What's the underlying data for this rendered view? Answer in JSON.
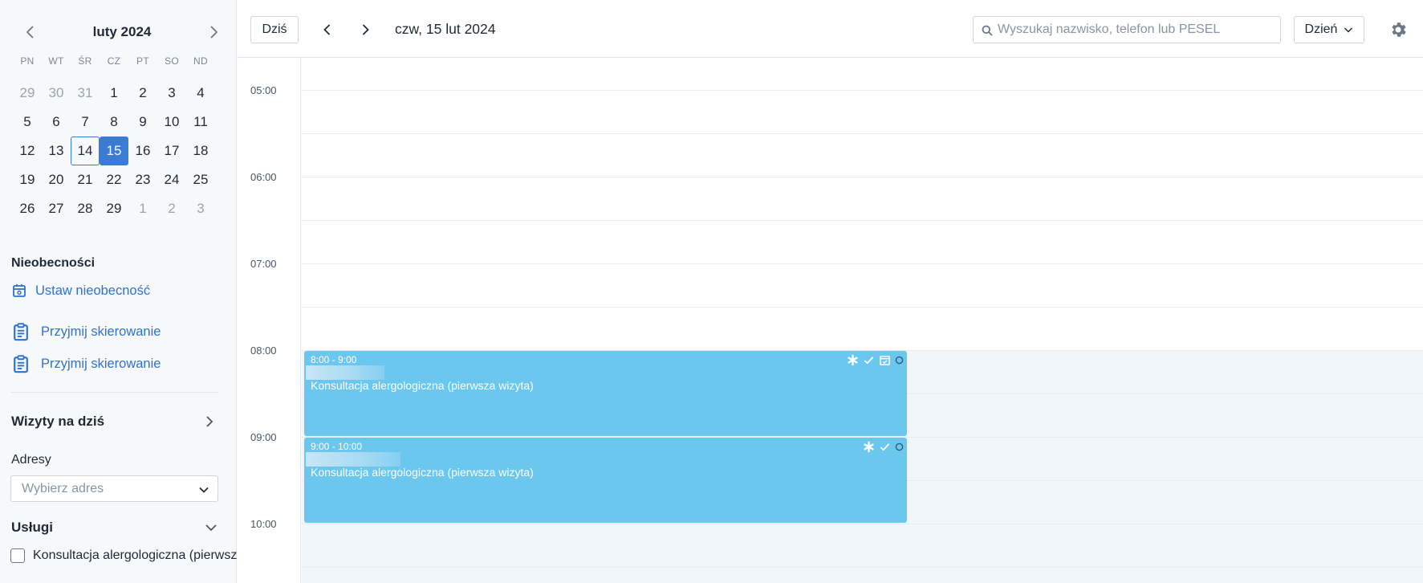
{
  "calendar": {
    "month_title": "luty 2024",
    "weekdays": [
      "PN",
      "WT",
      "ŚR",
      "CZ",
      "PT",
      "SO",
      "ND"
    ],
    "weeks": [
      [
        "29",
        "30",
        "31",
        "1",
        "2",
        "3",
        "4"
      ],
      [
        "5",
        "6",
        "7",
        "8",
        "9",
        "10",
        "11"
      ],
      [
        "12",
        "13",
        "14",
        "15",
        "16",
        "17",
        "18"
      ],
      [
        "19",
        "20",
        "21",
        "22",
        "23",
        "24",
        "25"
      ],
      [
        "26",
        "27",
        "28",
        "29",
        "1",
        "2",
        "3"
      ]
    ]
  },
  "sidebar": {
    "absences_title": "Nieobecności",
    "set_absence": "Ustaw nieobecność",
    "referral_1": "Przyjmij skierowanie",
    "referral_2": "Przyjmij skierowanie",
    "visits_today": "Wizyty na dziś",
    "addresses_title": "Adresy",
    "address_placeholder": "Wybierz adres",
    "services_title": "Usługi",
    "service_item": "Konsultacja alergologiczna (pierwsza wizyta)"
  },
  "toolbar": {
    "today_button": "Dziś",
    "date": "czw, 15 lut 2024",
    "search_placeholder": "Wyszukaj nazwisko, telefon lub PESEL",
    "view_label": "Dzień"
  },
  "time_labels": [
    "05:00",
    "06:00",
    "07:00",
    "08:00",
    "09:00",
    "10:00"
  ],
  "events": [
    {
      "time": "8:00 - 9:00",
      "title": "Konsultacja alergologiczna (pierwsza wizyta)"
    },
    {
      "time": "9:00 - 10:00",
      "title": "Konsultacja alergologiczna (pierwsza wizyta)"
    }
  ],
  "colors": {
    "accent": "#3a7bd5",
    "link": "#2f73c9",
    "event": "#6cc7ef",
    "working_hours": "#eff6fc"
  },
  "icons": {
    "prev": "chevron-left-icon",
    "next": "chevron-right-icon",
    "search": "search-icon",
    "settings": "gear-icon",
    "absence": "calendar-icon",
    "referral": "clipboard-icon"
  }
}
